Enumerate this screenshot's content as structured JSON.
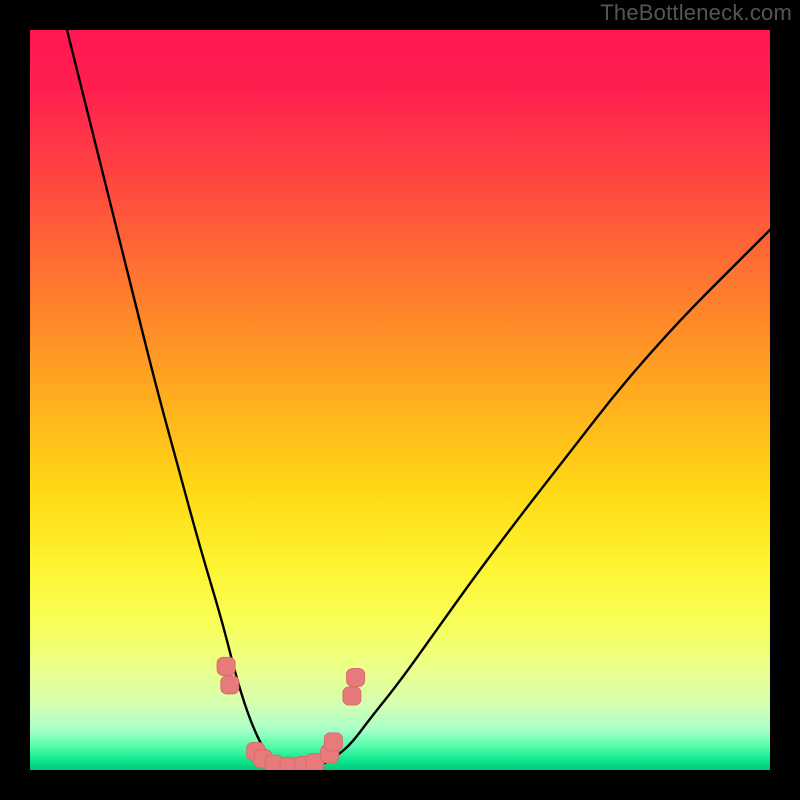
{
  "watermark": {
    "text": "TheBottleneck.com"
  },
  "colors": {
    "gradient_stops": [
      {
        "offset": 0.0,
        "color": "#ff1752"
      },
      {
        "offset": 0.08,
        "color": "#ff1f4f"
      },
      {
        "offset": 0.2,
        "color": "#ff4540"
      },
      {
        "offset": 0.35,
        "color": "#ff7a2e"
      },
      {
        "offset": 0.5,
        "color": "#ffae1f"
      },
      {
        "offset": 0.62,
        "color": "#ffd814"
      },
      {
        "offset": 0.72,
        "color": "#fff330"
      },
      {
        "offset": 0.8,
        "color": "#f8ff58"
      },
      {
        "offset": 0.86,
        "color": "#ecff88"
      },
      {
        "offset": 0.91,
        "color": "#d6ffb0"
      },
      {
        "offset": 0.945,
        "color": "#a8ffc8"
      },
      {
        "offset": 0.965,
        "color": "#5fffb0"
      },
      {
        "offset": 0.985,
        "color": "#15e990"
      },
      {
        "offset": 1.0,
        "color": "#00c97a"
      }
    ],
    "curve": "#000000",
    "marker_fill": "#e77b7b",
    "marker_stroke": "#d96a6a"
  },
  "chart_data": {
    "type": "line",
    "title": "",
    "xlabel": "",
    "ylabel": "",
    "xlim": [
      0,
      100
    ],
    "ylim": [
      0,
      100
    ],
    "note": "V-shaped bottleneck curve; valley ≈ 0 near x ≈ 32–40. Right branch rises more gently than left. Y represents bottleneck % (background hue encodes severity: green=0 → red=100).",
    "series": [
      {
        "name": "bottleneck-curve",
        "x": [
          5,
          8,
          11,
          14,
          17,
          20,
          23,
          26,
          28,
          30,
          32,
          34,
          36,
          38,
          40,
          43,
          46,
          50,
          55,
          60,
          66,
          73,
          80,
          88,
          96,
          100
        ],
        "y": [
          100,
          88,
          76,
          64,
          52,
          41,
          30,
          20,
          12,
          6,
          2,
          0,
          0,
          0,
          1,
          3,
          7,
          12,
          19,
          26,
          34,
          43,
          52,
          61,
          69,
          73
        ]
      }
    ],
    "markers": {
      "name": "data-points",
      "x": [
        26.5,
        27.0,
        30.5,
        31.5,
        33.0,
        35.0,
        37.0,
        38.5,
        40.5,
        41.0,
        43.5,
        44.0
      ],
      "y": [
        14.0,
        11.5,
        2.5,
        1.5,
        0.8,
        0.5,
        0.6,
        1.0,
        2.2,
        3.8,
        10.0,
        12.5
      ]
    }
  }
}
